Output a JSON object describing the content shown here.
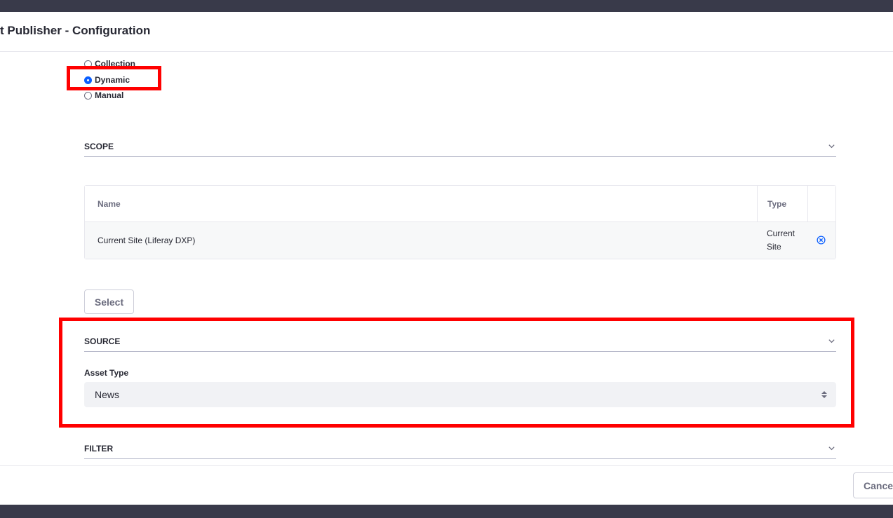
{
  "modal": {
    "title": "t Publisher - Configuration"
  },
  "asset_selection": {
    "options": [
      {
        "label": "Collection",
        "checked": false
      },
      {
        "label": "Dynamic",
        "checked": true
      },
      {
        "label": "Manual",
        "checked": false
      }
    ]
  },
  "scope": {
    "title": "SCOPE",
    "table": {
      "headers": [
        "Name",
        "Type"
      ],
      "rows": [
        {
          "name": "Current Site (Liferay DXP)",
          "type_line1": "Current",
          "type_line2": "Site"
        }
      ]
    },
    "select_button": "Select"
  },
  "source": {
    "title": "SOURCE",
    "asset_type_label": "Asset Type",
    "asset_type_value": "News"
  },
  "filter": {
    "title": "FILTER"
  },
  "footer": {
    "cancel_label": "Cancel"
  },
  "colors": {
    "accent": "#0b5fff",
    "highlight": "#ff0000",
    "chrome": "#393a4a"
  },
  "icons": {
    "section_toggle": "chevron-down-icon",
    "remove": "times-circle-icon",
    "select_arrows": "caret-double-icon"
  }
}
